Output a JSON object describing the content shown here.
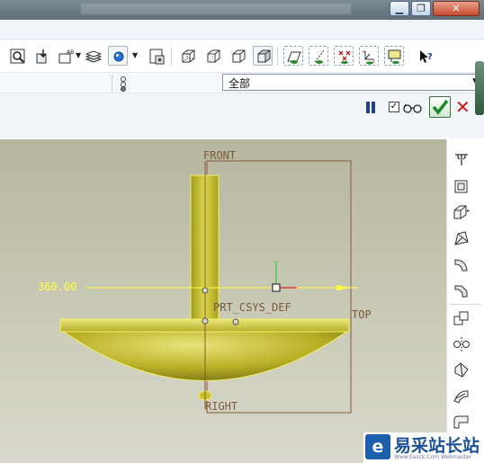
{
  "window": {
    "minimize_label": "▁",
    "restore_label": "❐",
    "close_label": "✕"
  },
  "toolbar": {
    "icons": [
      "zoom-window-icon",
      "repaint-icon",
      "named-view-icon",
      "layers-icon",
      "datum-display-icon",
      "dropdown-icon",
      "view-manager-icon",
      "wireframe-icon",
      "hidden-line-icon",
      "no-hidden-icon",
      "shading-icon",
      "datum-planes-icon",
      "datum-axes-icon",
      "datum-points-icon",
      "csys-icon",
      "annotation-icon",
      "help-icon"
    ]
  },
  "filter": {
    "selected": "全部"
  },
  "dashboard": {
    "checkbox_checked": true
  },
  "viewport": {
    "labels": {
      "front": "FRONT",
      "top": "TOP",
      "right": "RIGHT",
      "csys": "PRT_CSYS_DEF",
      "dimension": "360.00"
    },
    "colors": {
      "background": "#c0c1ab",
      "model": "#d6d23a",
      "datum": "#8a5a3a",
      "dimension": "#ffff40"
    }
  },
  "right_toolbar": {
    "icons": [
      "hole-icon",
      "shell-icon",
      "rib-icon",
      "draft-icon",
      "round-icon",
      "chamfer-icon",
      "copy-icon",
      "mirror-icon",
      "merge-icon",
      "trim-icon",
      "extend-icon"
    ]
  },
  "watermark": {
    "title": "易采站长站",
    "subtitle": "Www.Easck.Com  Webmaster"
  }
}
